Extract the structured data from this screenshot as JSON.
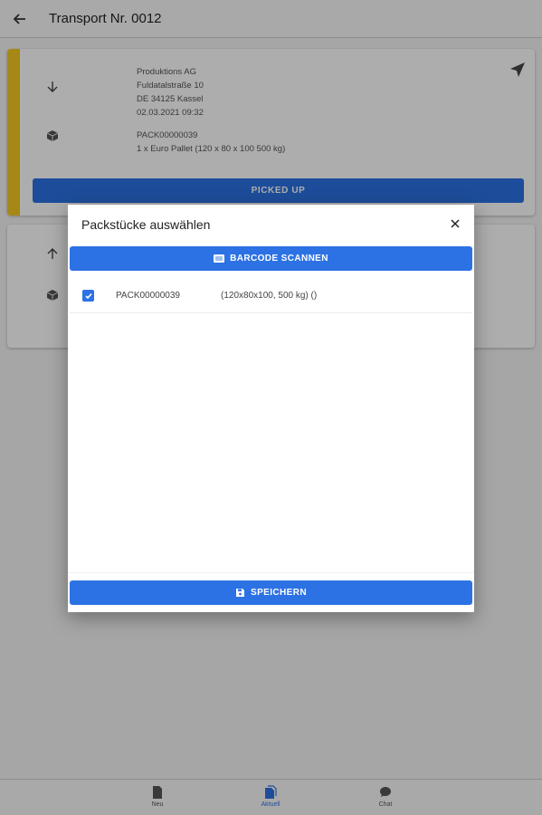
{
  "appbar": {
    "title": "Transport Nr. 0012",
    "back_icon": "arrow-left-icon"
  },
  "pickup_card": {
    "accent_color": "#f7c820",
    "address_lines": [
      "Produktions AG",
      "Fuldatalstraße 10",
      "DE 34125 Kassel",
      "02.03.2021 09:32"
    ],
    "package_lines": [
      "PACK00000039",
      "1 x Euro Pallet (120 x 80 x 100 500 kg)"
    ],
    "button_label": "PICKED UP"
  },
  "delivery_card": {},
  "dialog": {
    "title": "Packstücke auswählen",
    "scan_button_label": "BARCODE SCANNEN",
    "items": [
      {
        "code": "PACK00000039",
        "dimensions": "(120x80x100, 500 kg) ()",
        "checked": true
      }
    ],
    "save_button_label": "SPEICHERN"
  },
  "bottom_nav": {
    "items": [
      {
        "label": "Neu",
        "icon": "document-icon",
        "active": false
      },
      {
        "label": "Aktuell",
        "icon": "documents-icon",
        "active": true
      },
      {
        "label": "Chat",
        "icon": "chat-icon",
        "active": false
      }
    ]
  },
  "colors": {
    "primary": "#2c72e4",
    "accent": "#f7c820"
  }
}
